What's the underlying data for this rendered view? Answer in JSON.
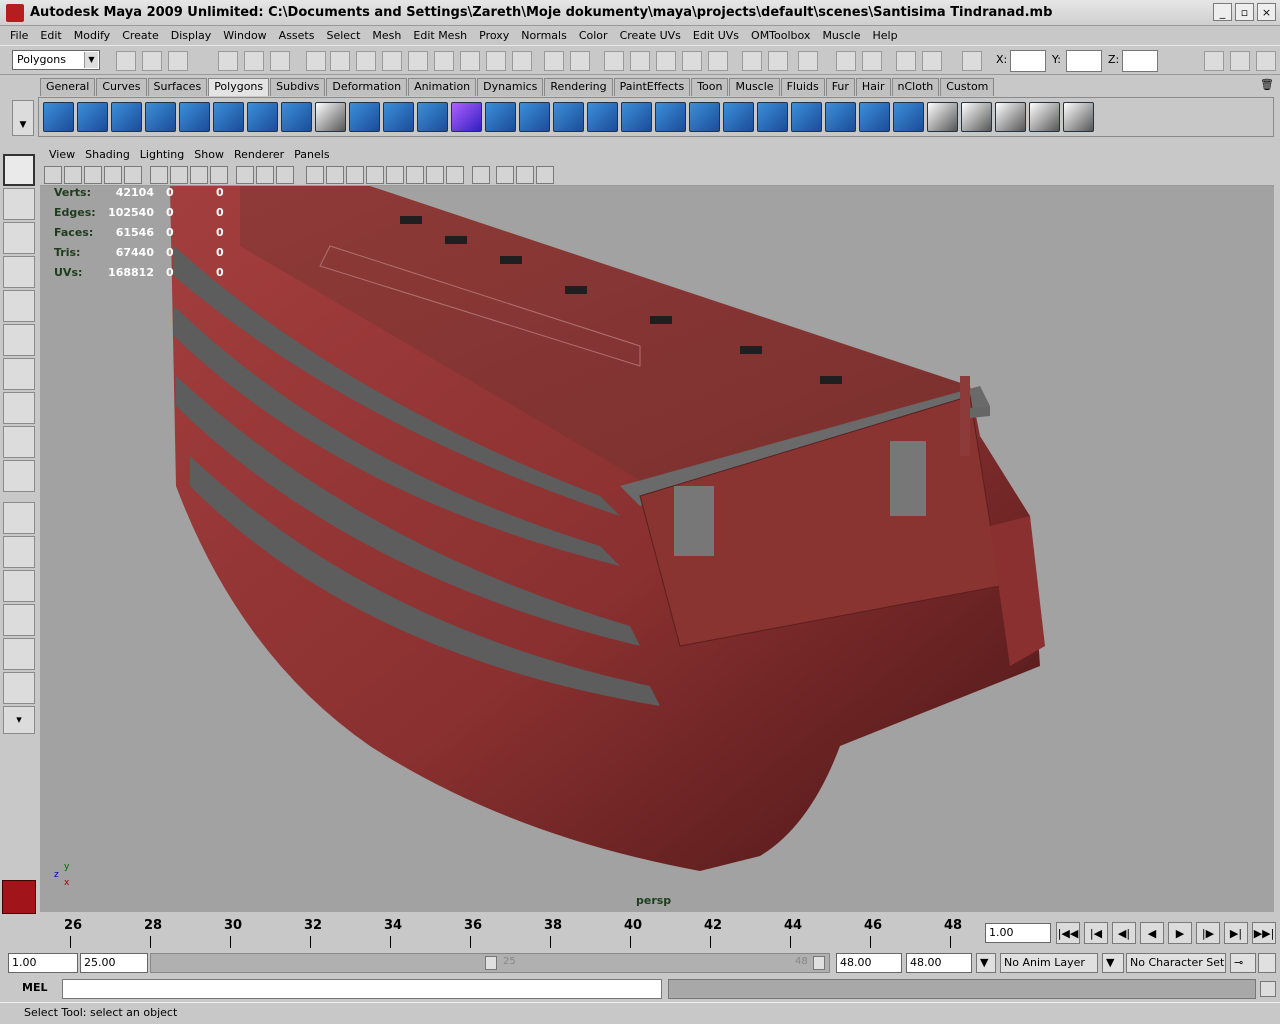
{
  "title": "Autodesk Maya 2009 Unlimited: C:\\Documents and Settings\\Zareth\\Moje dokumenty\\maya\\projects\\default\\scenes\\Santisima Tindranad.mb",
  "menu": [
    "File",
    "Edit",
    "Modify",
    "Create",
    "Display",
    "Window",
    "Assets",
    "Select",
    "Mesh",
    "Edit Mesh",
    "Proxy",
    "Normals",
    "Color",
    "Create UVs",
    "Edit UVs",
    "OMToolbox",
    "Muscle",
    "Help"
  ],
  "status_line": {
    "mode": "Polygons",
    "x_label": "X:",
    "y_label": "Y:",
    "z_label": "Z:"
  },
  "shelf_tabs": [
    "General",
    "Curves",
    "Surfaces",
    "Polygons",
    "Subdivs",
    "Deformation",
    "Animation",
    "Dynamics",
    "Rendering",
    "PaintEffects",
    "Toon",
    "Muscle",
    "Fluids",
    "Fur",
    "Hair",
    "nCloth",
    "Custom"
  ],
  "active_shelf": "Polygons",
  "panel_menu": [
    "View",
    "Shading",
    "Lighting",
    "Show",
    "Renderer",
    "Panels"
  ],
  "hud": [
    {
      "label": "Verts:",
      "value": "42104",
      "sel": "0",
      "sel2": "0"
    },
    {
      "label": "Edges:",
      "value": "102540",
      "sel": "0",
      "sel2": "0"
    },
    {
      "label": "Faces:",
      "value": "61546",
      "sel": "0",
      "sel2": "0"
    },
    {
      "label": "Tris:",
      "value": "67440",
      "sel": "0",
      "sel2": "0"
    },
    {
      "label": "UVs:",
      "value": "168812",
      "sel": "0",
      "sel2": "0"
    }
  ],
  "camera_label": "persp",
  "timeline": {
    "ticks": [
      "26",
      "28",
      "30",
      "32",
      "34",
      "36",
      "38",
      "40",
      "42",
      "44",
      "46",
      "48"
    ],
    "current_time": "1.00"
  },
  "range": {
    "start": "1.00",
    "range_start": "25.00",
    "range_end": "48.00",
    "end": "48.00",
    "slider_start_label": "25",
    "slider_end_label": "48"
  },
  "anim_layer": "No Anim Layer",
  "character_set": "No Character Set",
  "command": {
    "label": "MEL"
  },
  "help_line": "Select Tool: select an object",
  "axis_labels": {
    "y": "y",
    "z": "z",
    "x": "x"
  }
}
